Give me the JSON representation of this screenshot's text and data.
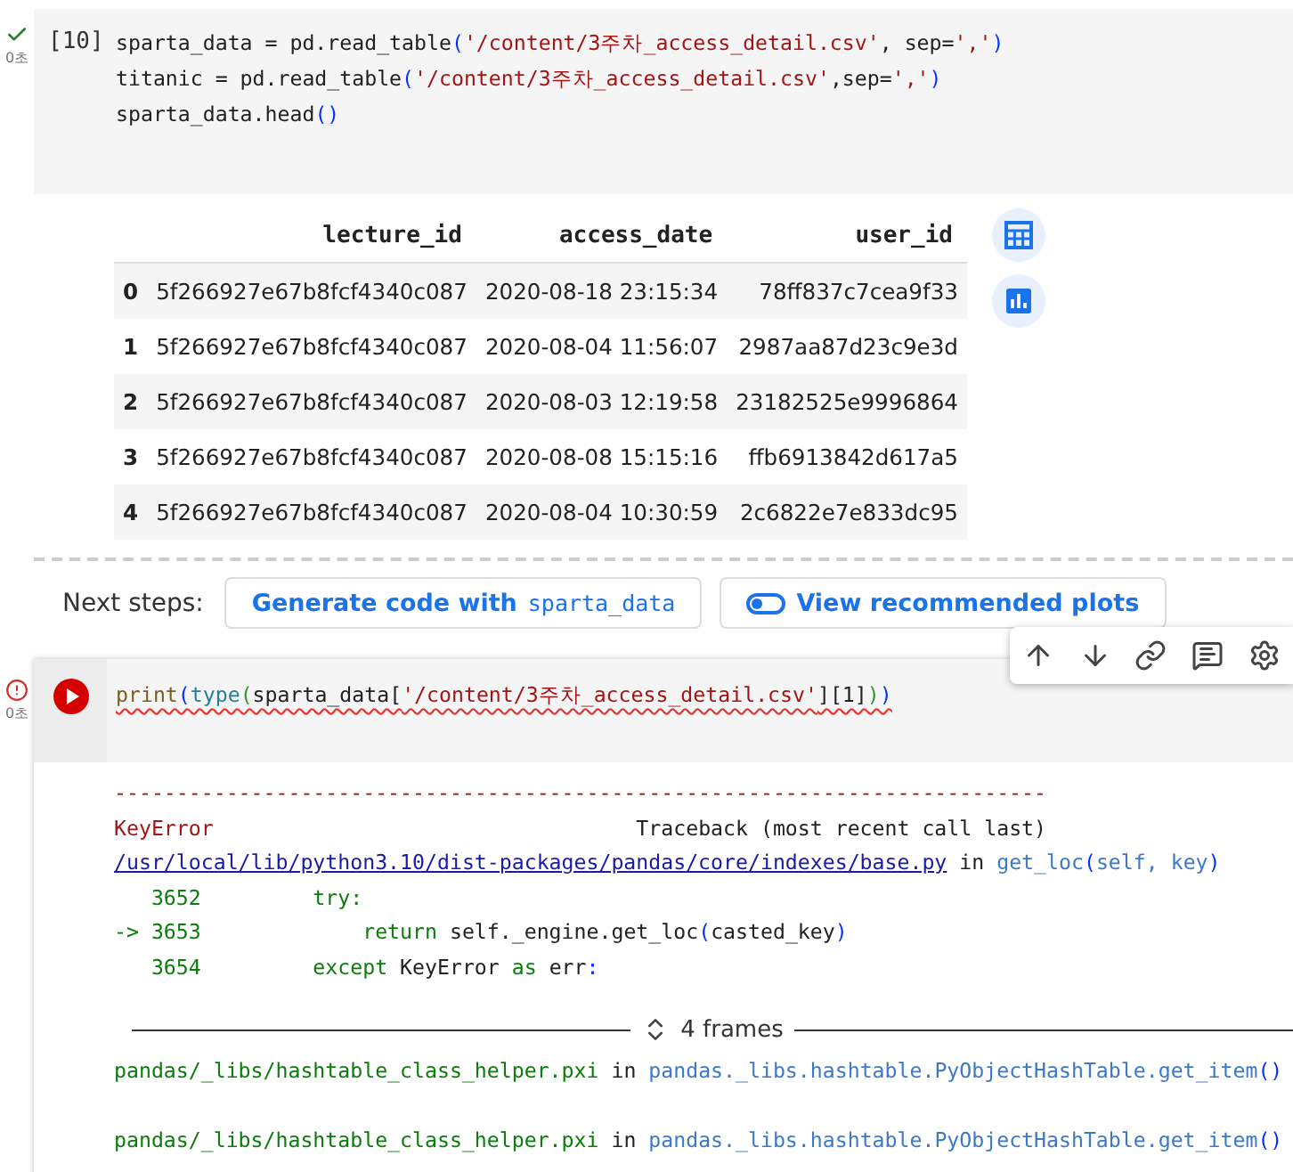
{
  "cell_1": {
    "error": false,
    "time": "0초",
    "execution_count": "[10]",
    "code": [
      [
        {
          "kind": "plain",
          "text": "sparta_data = pd.read_table"
        },
        {
          "kind": "paren",
          "text": "("
        },
        {
          "kind": "string",
          "text": "'/content/3주차_access_detail.csv'"
        },
        {
          "kind": "plain",
          "text": ", sep="
        },
        {
          "kind": "string",
          "text": "','"
        },
        {
          "kind": "paren",
          "text": ")"
        }
      ],
      [
        {
          "kind": "plain",
          "text": "titanic = pd.read_table"
        },
        {
          "kind": "paren",
          "text": "("
        },
        {
          "kind": "string",
          "text": "'/content/3주차_access_detail.csv'"
        },
        {
          "kind": "plain",
          "text": ",sep="
        },
        {
          "kind": "string",
          "text": "','"
        },
        {
          "kind": "paren",
          "text": ")"
        }
      ],
      [
        {
          "kind": "plain",
          "text": "sparta_data.head"
        },
        {
          "kind": "paren",
          "text": "()"
        }
      ]
    ]
  },
  "output_table": {
    "columns": [
      "",
      "lecture_id",
      "access_date",
      "user_id"
    ],
    "rows": [
      [
        "0",
        "5f266927e67b8fcf4340c087",
        "2020-08-18 23:15:34",
        "78ff837c7cea9f33"
      ],
      [
        "1",
        "5f266927e67b8fcf4340c087",
        "2020-08-04 11:56:07",
        "2987aa87d23c9e3d"
      ],
      [
        "2",
        "5f266927e67b8fcf4340c087",
        "2020-08-03 12:19:58",
        "23182525e9996864"
      ],
      [
        "3",
        "5f266927e67b8fcf4340c087",
        "2020-08-08 15:15:16",
        "ffb6913842d617a5"
      ],
      [
        "4",
        "5f266927e67b8fcf4340c087",
        "2020-08-04 10:30:59",
        "2c6822e7e833dc95"
      ]
    ]
  },
  "next_steps": {
    "label": "Next steps:",
    "generate_button": {
      "text": "Generate code with",
      "code": "sparta_data"
    },
    "plots_button": "View recommended plots"
  },
  "cell_2": {
    "error": true,
    "time": "0초",
    "code": [
      [
        {
          "kind": "func",
          "text": "print"
        },
        {
          "kind": "paren",
          "text": "("
        },
        {
          "kind": "builtin",
          "text": "type"
        },
        {
          "kind": "paren2",
          "text": "("
        },
        {
          "kind": "plain",
          "text": "sparta_data["
        },
        {
          "kind": "string",
          "text": "'/content/3주차_access_detail.csv'"
        },
        {
          "kind": "plain",
          "text": "][1]"
        },
        {
          "kind": "paren2",
          "text": ")"
        },
        {
          "kind": "paren",
          "text": ")"
        }
      ]
    ]
  },
  "error_output": {
    "lines": [
      [
        {
          "kind": "error",
          "text": "---------------------------------------------------------------------------"
        }
      ],
      [
        {
          "kind": "error",
          "text": "KeyError"
        },
        {
          "kind": "plain",
          "text": "                                  Traceback (most recent call last)"
        }
      ],
      [
        {
          "kind": "link",
          "text": "/usr/local/lib/python3.10/dist-packages/pandas/core/indexes/base.py"
        },
        {
          "kind": "plain",
          "text": " in "
        },
        {
          "kind": "func",
          "text": "get_loc"
        },
        {
          "kind": "paren",
          "text": "("
        },
        {
          "kind": "func",
          "text": "self, key"
        },
        {
          "kind": "paren",
          "text": ")"
        }
      ],
      [
        {
          "kind": "green",
          "text": "   3652         try:"
        }
      ],
      [
        {
          "kind": "green",
          "text": "-> 3653             return "
        },
        {
          "kind": "plain",
          "text": "self._engine.get_loc"
        },
        {
          "kind": "paren",
          "text": "("
        },
        {
          "kind": "plain",
          "text": "casted_key"
        },
        {
          "kind": "paren",
          "text": ")"
        }
      ],
      [
        {
          "kind": "green",
          "text": "   3654         except "
        },
        {
          "kind": "plain",
          "text": "KeyError "
        },
        {
          "kind": "green",
          "text": "as "
        },
        {
          "kind": "plain",
          "text": "err"
        },
        {
          "kind": "paren",
          "text": ":"
        }
      ]
    ],
    "frames_label": "4 frames",
    "frames": [
      [
        {
          "kind": "green",
          "text": "pandas/_libs/hashtable_class_helper.pxi"
        },
        {
          "kind": "plain",
          "text": " in "
        },
        {
          "kind": "func",
          "text": "pandas._libs.hashtable.PyObjectHashTable.get_item"
        },
        {
          "kind": "paren",
          "text": "()"
        }
      ],
      [
        {
          "kind": "green",
          "text": "pandas/_libs/hashtable_class_helper.pxi"
        },
        {
          "kind": "plain",
          "text": " in "
        },
        {
          "kind": "func",
          "text": "pandas._libs.hashtable.PyObjectHashTable.get_item"
        },
        {
          "kind": "paren",
          "text": "()"
        }
      ]
    ]
  }
}
